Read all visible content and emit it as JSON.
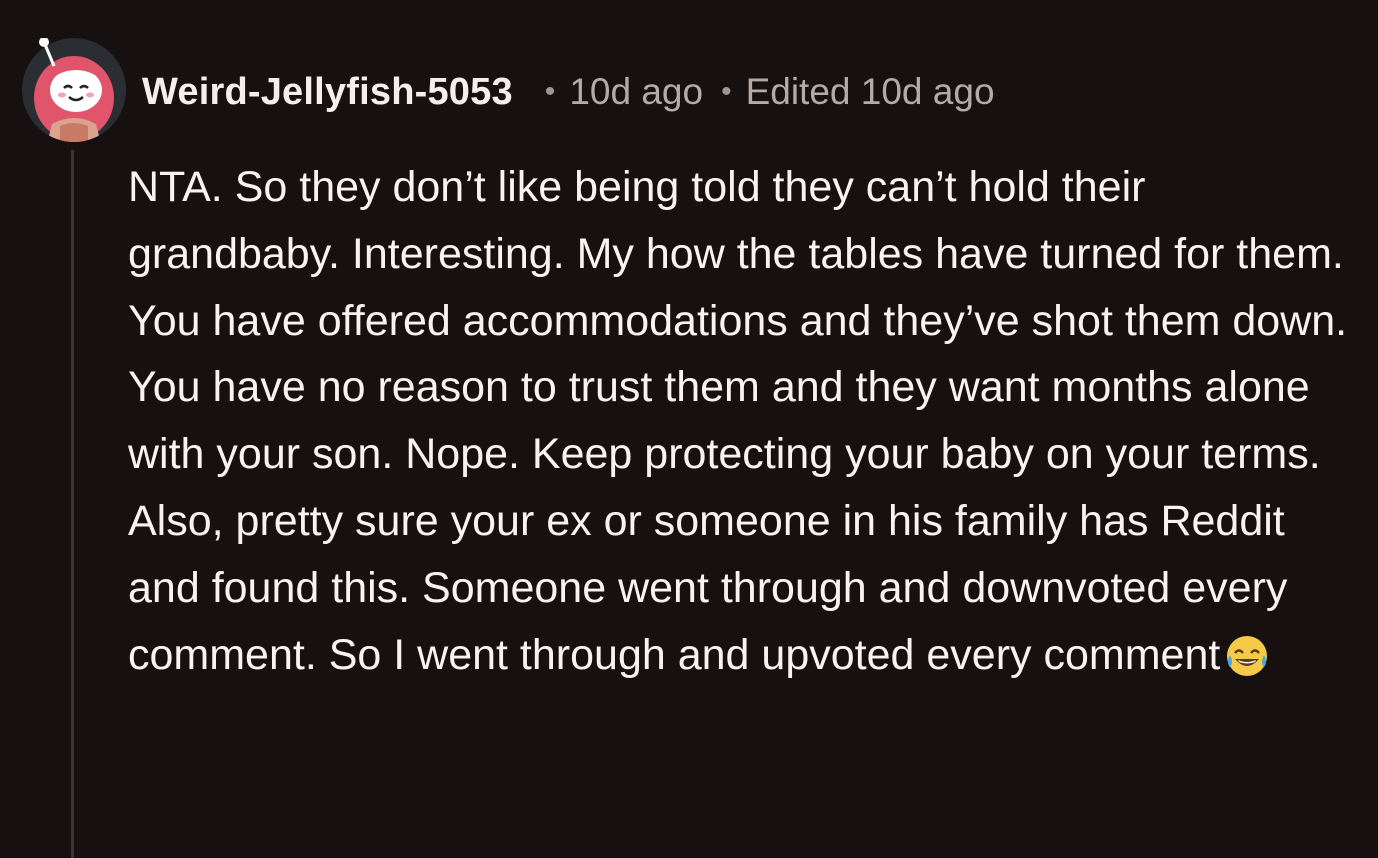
{
  "comment": {
    "author": "Weird-Jellyfish-5053",
    "separator": "•",
    "posted": "10d ago",
    "edited": "Edited 10d ago",
    "body": "NTA. So they don’t like being told they can’t hold their grandbaby. Interesting. My how the tables have turned for them. You have offered accommodations and they’ve shot them down. You have no reason to trust them and they want months alone with your son. Nope. Keep protecting your baby on your terms. Also, pretty sure your ex or someone in his family has Reddit and found this. Someone went through and downvoted every comment. So I went through and upvoted every comment",
    "emoji_icon": "face-with-tears-of-joy-icon"
  },
  "colors": {
    "background": "#161110",
    "text": "#f6f3f2",
    "meta_text": "#b4aaa8",
    "thread_line": "#3a3432",
    "avatar_accent": "#e0556b"
  }
}
